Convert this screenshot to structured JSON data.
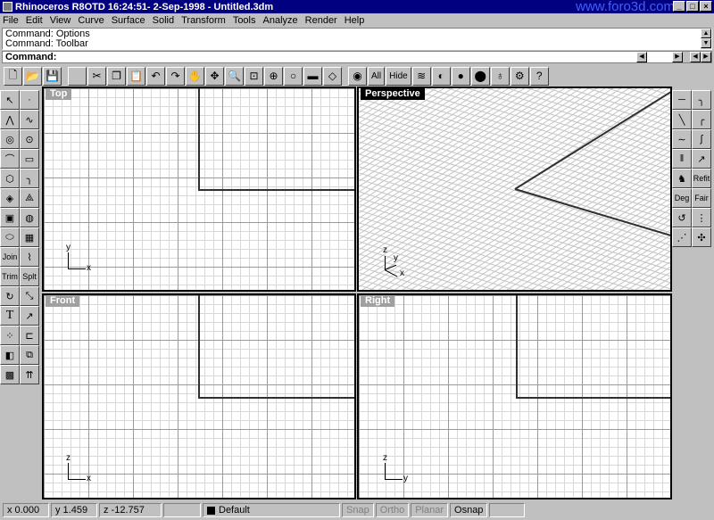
{
  "window": {
    "title": "Rhinoceros R8OTD 16:24:51- 2-Sep-1998 - Untitled.3dm",
    "watermark": "www.foro3d.com",
    "controls": [
      "_",
      "□",
      "×"
    ]
  },
  "menubar": [
    "File",
    "Edit",
    "View",
    "Curve",
    "Surface",
    "Solid",
    "Transform",
    "Tools",
    "Analyze",
    "Render",
    "Help"
  ],
  "command_history": [
    "Command: Options",
    "Command: Toolbar"
  ],
  "command_prompt": "Command:",
  "toolbar": {
    "all_label": "All",
    "hide_label": "Hide"
  },
  "left_tools": {
    "join_label": "Join",
    "split_label": "Splt",
    "trim_label": "Trim",
    "text_label": "T"
  },
  "right_tools": {
    "refit_label": "Refit",
    "deg_label": "Deg",
    "fair_label": "Fair"
  },
  "viewports": {
    "top": {
      "label": "Top",
      "axis_v": "y",
      "axis_h": "x"
    },
    "perspective": {
      "label": "Perspective",
      "axis_v": "z",
      "axis_h": "x",
      "axis_y": "y"
    },
    "front": {
      "label": "Front",
      "axis_v": "z",
      "axis_h": "x"
    },
    "right": {
      "label": "Right",
      "axis_v": "z",
      "axis_h": "y"
    }
  },
  "status": {
    "x": "x 0.000",
    "y": "y 1.459",
    "z": "z -12.757",
    "layer": "Default",
    "snap": "Snap",
    "ortho": "Ortho",
    "planar": "Planar",
    "osnap": "Osnap"
  }
}
